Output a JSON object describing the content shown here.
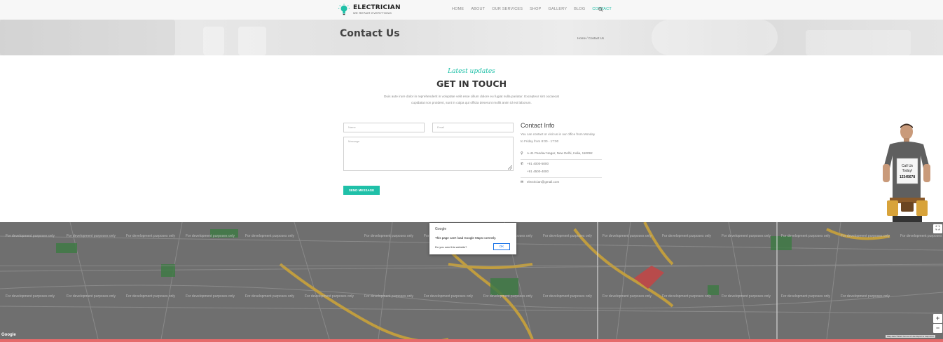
{
  "header": {
    "logo_title": "ELECTRICIAN",
    "logo_tagline": "WE REPAIR EVERYTHING",
    "nav": [
      "HOME",
      "ABOUT",
      "OUR SERVICES",
      "SHOP",
      "GALLERY",
      "BLOG",
      "CONTACT"
    ],
    "active_nav": "CONTACT",
    "accent_color": "#1fc0a8"
  },
  "banner": {
    "title": "Contact Us",
    "breadcrumb": "Home / Contact Us"
  },
  "section": {
    "script_title": "Latest updates",
    "title": "GET IN TOUCH",
    "lead_line1": "Duis aute irure dolor in reprehenderit in voluptate velit esse cillum dolore eu fugiat nulla pariatur. Excepteur sint occaecat",
    "lead_line2": "cupidatat non proident, sunt in culpa qui officia deserunt mollit anim id est laborum."
  },
  "form": {
    "name_placeholder": "Name",
    "email_placeholder": "Email",
    "message_placeholder": "Message",
    "send_label": "SEND MESSAGE"
  },
  "contact_info": {
    "title": "Contact Info",
    "text_line1": "You can contact or visit us in our office from Monday",
    "text_line2": "to Friday from 8:00 - 17:00",
    "address": "A-41 Pandav Nagar, New Delhi, India, 110092",
    "phone1": "+91 4000-5000",
    "phone2": "+91 4500-4000",
    "email": "electrician@gmail.com"
  },
  "mascot": {
    "sign_line1": "Call Us",
    "sign_line2": "Today!",
    "sign_number": "12345678"
  },
  "map": {
    "watermark": "For development purposes only",
    "dialog_title": "Google",
    "dialog_message": "This page can't load Google Maps correctly.",
    "dialog_question": "Do you own this website?",
    "dialog_ok": "OK",
    "google_logo": "Google",
    "attribution": "Map data ©2021   Terms of Use   Report a map error",
    "zoom_in": "+",
    "zoom_out": "−",
    "fullscreen": "⛶"
  }
}
